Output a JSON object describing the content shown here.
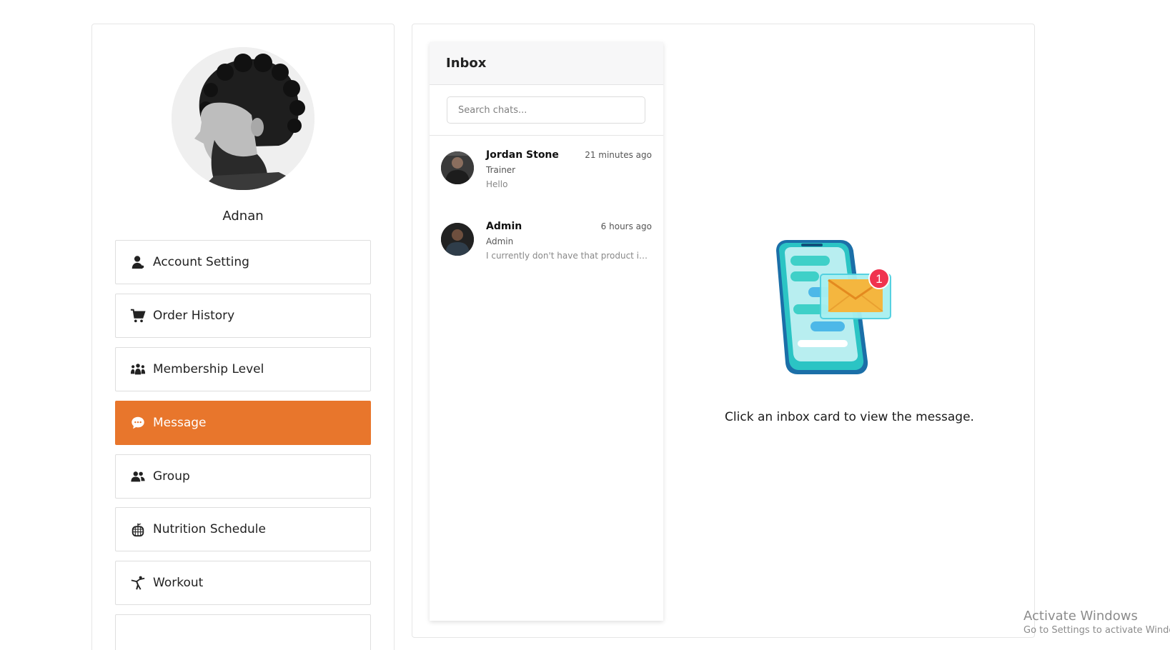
{
  "profile": {
    "name": "Adnan"
  },
  "menu": {
    "items": [
      {
        "label": "Account Setting",
        "icon": "user-icon"
      },
      {
        "label": "Order History",
        "icon": "cart-icon"
      },
      {
        "label": "Membership Level",
        "icon": "people-icon"
      },
      {
        "label": "Message",
        "icon": "chat-icon"
      },
      {
        "label": "Group",
        "icon": "group-icon"
      },
      {
        "label": "Nutrition Schedule",
        "icon": "nutrition-icon"
      },
      {
        "label": "Workout",
        "icon": "workout-icon"
      }
    ],
    "active": "Message",
    "accent_color": "#e8762c"
  },
  "inbox": {
    "title": "Inbox",
    "search_placeholder": "Search chats...",
    "chats": [
      {
        "name": "Jordan Stone",
        "time": "21 minutes ago",
        "role": "Trainer",
        "preview": "Hello"
      },
      {
        "name": "Admin",
        "time": "6 hours ago",
        "role": "Admin",
        "preview": "I currently don't have that product in..."
      }
    ]
  },
  "empty_state": {
    "text": "Click an inbox card to view the message.",
    "badge_count": "1"
  },
  "watermark": {
    "line1": "Activate Windows",
    "line2": "Go to Settings to activate Windows."
  }
}
